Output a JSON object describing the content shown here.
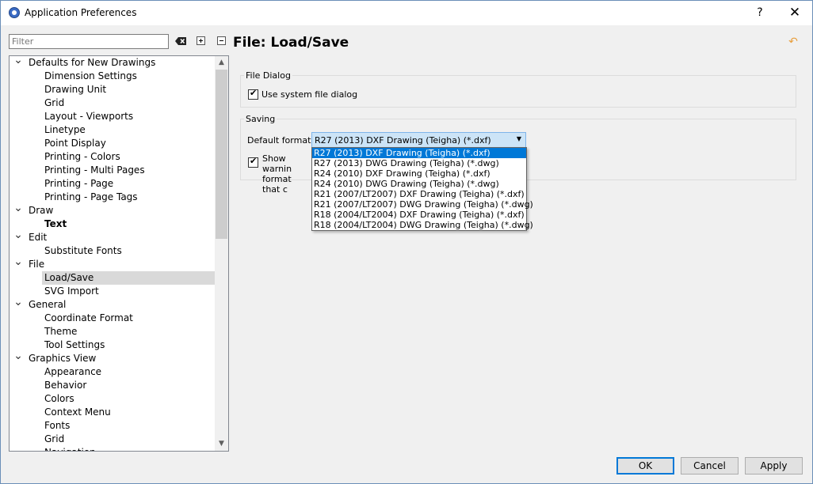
{
  "window": {
    "title": "Application Preferences",
    "help": "?",
    "close": "✕"
  },
  "filter": {
    "placeholder": "Filter",
    "value": ""
  },
  "tree": [
    {
      "label": "Defaults for New Drawings",
      "level": 0,
      "caret": "open"
    },
    {
      "label": "Dimension Settings",
      "level": 1
    },
    {
      "label": "Drawing Unit",
      "level": 1
    },
    {
      "label": "Grid",
      "level": 1
    },
    {
      "label": "Layout - Viewports",
      "level": 1
    },
    {
      "label": "Linetype",
      "level": 1
    },
    {
      "label": "Point Display",
      "level": 1
    },
    {
      "label": "Printing - Colors",
      "level": 1
    },
    {
      "label": "Printing - Multi Pages",
      "level": 1
    },
    {
      "label": "Printing - Page",
      "level": 1
    },
    {
      "label": "Printing - Page Tags",
      "level": 1
    },
    {
      "label": "Draw",
      "level": 0,
      "caret": "open"
    },
    {
      "label": "Text",
      "level": 1,
      "bold": true
    },
    {
      "label": "Edit",
      "level": 0,
      "caret": "open"
    },
    {
      "label": "Substitute Fonts",
      "level": 1
    },
    {
      "label": "File",
      "level": 0,
      "caret": "open"
    },
    {
      "label": "Load/Save",
      "level": 1,
      "selected": true
    },
    {
      "label": "SVG Import",
      "level": 1
    },
    {
      "label": "General",
      "level": 0,
      "caret": "open"
    },
    {
      "label": "Coordinate Format",
      "level": 1
    },
    {
      "label": "Theme",
      "level": 1
    },
    {
      "label": "Tool Settings",
      "level": 1
    },
    {
      "label": "Graphics View",
      "level": 0,
      "caret": "open"
    },
    {
      "label": "Appearance",
      "level": 1
    },
    {
      "label": "Behavior",
      "level": 1
    },
    {
      "label": "Colors",
      "level": 1
    },
    {
      "label": "Context Menu",
      "level": 1
    },
    {
      "label": "Fonts",
      "level": 1
    },
    {
      "label": "Grid",
      "level": 1
    },
    {
      "label": "Navigation",
      "level": 1
    }
  ],
  "page": {
    "title": "File: Load/Save"
  },
  "file_dialog": {
    "group_title": "File Dialog",
    "use_system_label": "Use system file dialog",
    "use_system_checked": true
  },
  "saving": {
    "group_title": "Saving",
    "default_format_label": "Default format:",
    "default_format_value": "R27 (2013) DXF Drawing (Teigha) (*.dxf)",
    "warning_label": "Show warnin format that c",
    "warning_checked": true,
    "options": [
      "R27 (2013) DXF Drawing (Teigha) (*.dxf)",
      "R27 (2013) DWG Drawing (Teigha) (*.dwg)",
      "R24 (2010) DXF Drawing (Teigha) (*.dxf)",
      "R24 (2010) DWG Drawing (Teigha) (*.dwg)",
      "R21 (2007/LT2007) DXF Drawing (Teigha) (*.dxf)",
      "R21 (2007/LT2007) DWG Drawing (Teigha) (*.dwg)",
      "R18 (2004/LT2004) DXF Drawing (Teigha) (*.dxf)",
      "R18 (2004/LT2004) DWG Drawing (Teigha) (*.dwg)"
    ],
    "highlighted_option": 0
  },
  "buttons": {
    "ok": "OK",
    "cancel": "Cancel",
    "apply": "Apply"
  }
}
